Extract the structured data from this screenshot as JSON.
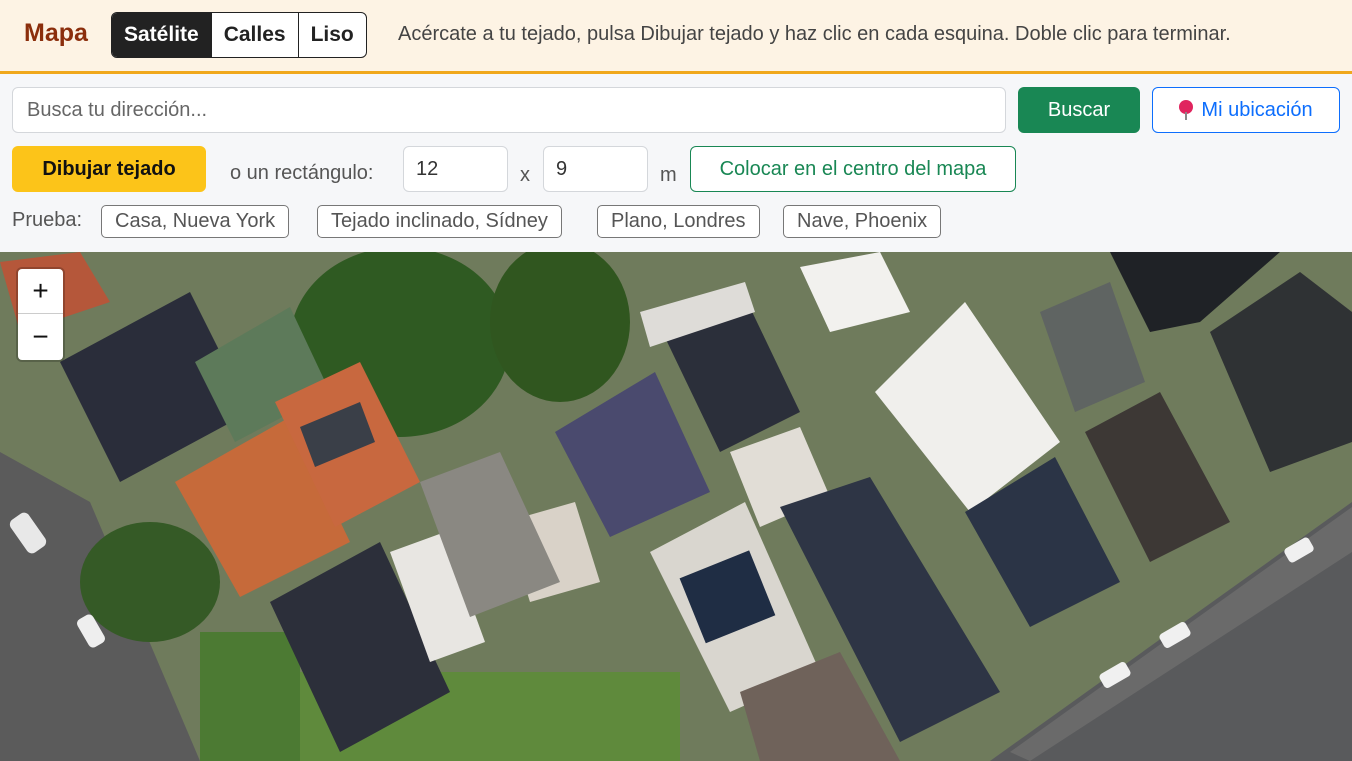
{
  "header": {
    "title": "Mapa",
    "layers": [
      {
        "label": "Satélite",
        "active": true
      },
      {
        "label": "Calles",
        "active": false
      },
      {
        "label": "Liso",
        "active": false
      }
    ],
    "hint": "Acércate a tu tejado, pulsa Dibujar tejado y haz clic en cada esquina. Doble clic para terminar."
  },
  "search": {
    "placeholder": "Busca tu dirección...",
    "value": "",
    "button_label": "Buscar",
    "location_label": "Mi ubicación"
  },
  "draw": {
    "button_label": "Dibujar tejado",
    "rect_label": "o un rectángulo:",
    "width": "12",
    "x_label": "x",
    "height": "9",
    "unit": "m",
    "center_label": "Colocar en el centro del mapa"
  },
  "examples": {
    "label": "Prueba:",
    "items": [
      "Casa, Nueva York",
      "Tejado inclinado, Sídney",
      "Plano, Londres",
      "Nave, Phoenix"
    ]
  },
  "map": {
    "zoom_in": "+",
    "zoom_out": "−",
    "colors": {
      "accent": "#f0a81c",
      "primary": "#198754",
      "link": "#0d6efd",
      "draw": "#fcc419"
    }
  }
}
